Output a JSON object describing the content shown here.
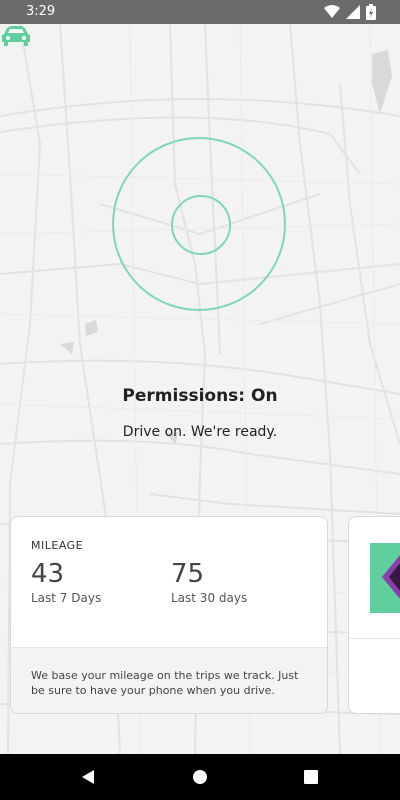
{
  "status_bar": {
    "time": "3:29",
    "icons": [
      "wifi-icon",
      "signal-icon",
      "battery-icon"
    ]
  },
  "map": {
    "accent_color": "#7fd7b6",
    "car_color": "#5fcf9e"
  },
  "permissions": {
    "title": "Permissions: On",
    "subtitle": "Drive on. We're ready."
  },
  "mileage_card": {
    "label": "MILEAGE",
    "metrics": [
      {
        "value": "43",
        "caption": "Last 7 Days"
      },
      {
        "value": "75",
        "caption": "Last 30 days"
      }
    ],
    "footnote": "We base your mileage on the trips we track. Just be sure to have your phone when you drive."
  },
  "nav_bar": {
    "buttons": [
      "back-icon",
      "home-icon",
      "recents-icon"
    ]
  }
}
